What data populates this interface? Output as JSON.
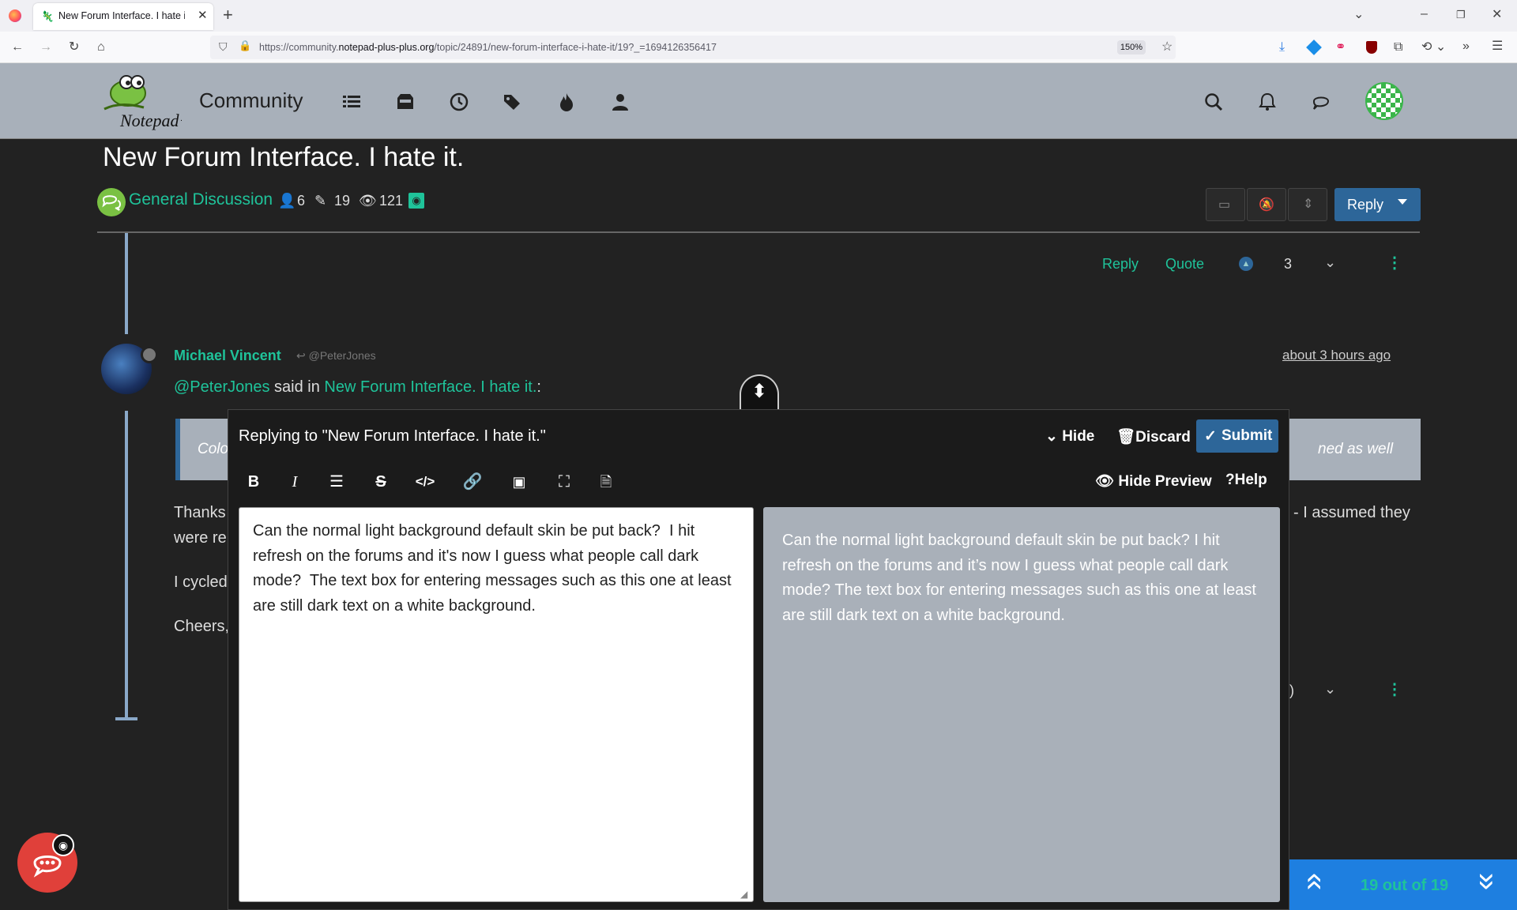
{
  "browser": {
    "tab_title": "New Forum Interface. I hate it. |",
    "new_tab": "+",
    "url_prefix": "https://community.",
    "url_domain": "notepad-plus-plus.org",
    "url_path": "/topic/24891/new-forum-interface-i-hate-it/19?_=1694126356417",
    "zoom": "150%"
  },
  "site": {
    "name": "Community"
  },
  "topic": {
    "title": "New Forum Interface. I hate it.",
    "category": "General Discussion",
    "posters": "6",
    "posts": "19",
    "views": "121",
    "reply_button": "Reply"
  },
  "post1": {
    "reply": "Reply",
    "quote": "Quote",
    "votes": "3"
  },
  "post2": {
    "author": "Michael Vincent",
    "reply_to": "@PeterJones",
    "time": "about 3 hours ago",
    "mention": "@PeterJones",
    "said_in": "said in",
    "topic_link": "New Forum Interface. I hate it.",
    "colon": ":",
    "quote_left": "Colo",
    "quote_right": "ned as well",
    "line1_left": "Thanks",
    "line1_right": "- I assumed they",
    "line2_left": "were re",
    "line3_left": "I cycled",
    "line4_left": "Cheers,",
    "votes_partial": ")"
  },
  "composer": {
    "title": "Replying to \"New Forum Interface. I hate it.\"",
    "hide": "Hide",
    "discard": "Discard",
    "submit": "Submit",
    "hide_preview": "Hide Preview",
    "help": "Help",
    "editor_text": "Can the normal light background default skin be put back?  I hit refresh on the forums and it's now I guess what people call dark mode?  The text box for entering messages such as this one at least are still dark text on a white background.",
    "preview_text": "Can the normal light background default skin be put back? I hit refresh on the forums and it’s now I guess what people call dark mode? The text box for entering messages such as this one at least are still dark text on a white background."
  },
  "pager": {
    "text": "19 out of 19"
  }
}
